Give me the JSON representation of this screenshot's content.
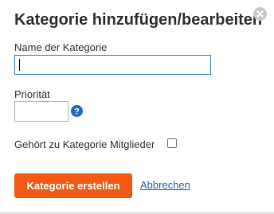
{
  "dialog": {
    "title": "Kategorie hinzufügen/bearbeiten",
    "close_icon": "close-circle-icon"
  },
  "form": {
    "name": {
      "label": "Name der Kategorie",
      "value": "",
      "focused": true
    },
    "priority": {
      "label": "Priorität",
      "value": "",
      "help_icon": "question-mark-icon"
    },
    "members_checkbox": {
      "label": "Gehört zu Kategorie Mitglieder",
      "checked": false
    }
  },
  "actions": {
    "create_label": "Kategorie erstellen",
    "cancel_label": "Abbrechen"
  },
  "colors": {
    "primary_button": "#f25a14",
    "link": "#2b65b3",
    "focus_border": "#4a90c8",
    "help_icon": "#1e6fc9",
    "close_icon": "#c8c8c8"
  }
}
